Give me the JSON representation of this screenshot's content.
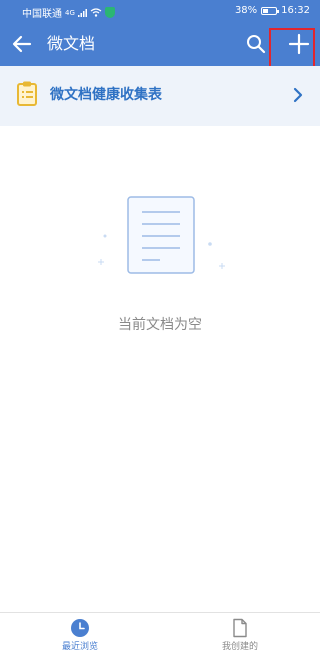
{
  "status_bar": {
    "carrier": "中国联通",
    "network": "4G",
    "battery": "38%",
    "battery_level": 0.38,
    "time": "16:32",
    "icons": [
      "signal-icon",
      "wifi-icon",
      "shield-icon",
      "battery-icon"
    ]
  },
  "app_bar": {
    "title": "微文档",
    "icons": [
      "back-arrow-icon",
      "search-icon",
      "plus-icon"
    ]
  },
  "collect_row": {
    "label": "微文档健康收集表",
    "icons": [
      "clipboard-icon",
      "chevron-right-icon"
    ]
  },
  "empty_state": {
    "message": "当前文档为空",
    "icon": "empty-document-icon"
  },
  "tabs": [
    {
      "label": "最近浏览",
      "icon": "clock-icon",
      "active": true
    },
    {
      "label": "我创建的",
      "icon": "document-icon",
      "active": false
    }
  ],
  "colors": {
    "primary": "#4a7fd0",
    "accent_blue": "#2f72c4",
    "clipboard": "#e8b834",
    "highlight": "#e2262d",
    "row_bg": "#eef3fa",
    "muted_text": "#8a8a8a"
  }
}
